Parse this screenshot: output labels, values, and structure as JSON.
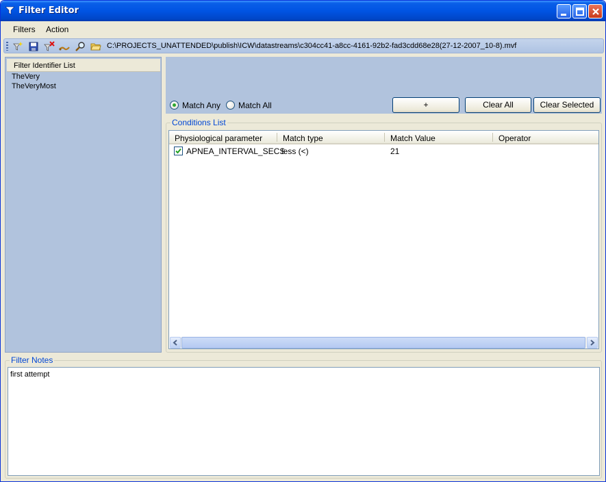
{
  "window": {
    "title": "Filter Editor"
  },
  "menu": {
    "filters": "Filters",
    "action": "Action"
  },
  "toolbar": {
    "icons": [
      "new-filter-icon",
      "save-icon",
      "delete-icon",
      "link-icon",
      "search-icon",
      "open-folder-icon"
    ],
    "path": "C:\\PROJECTS_UNATTENDED\\publish\\ICW\\datastreams\\c304cc41-a8cc-4161-92b2-fad3cdd68e28(27-12-2007_10-8).mvf"
  },
  "filter_list": {
    "header": "Filter Identifier List",
    "items": [
      "TheVery",
      "TheVeryMost"
    ]
  },
  "match": {
    "any_label": "Match Any",
    "all_label": "Match All",
    "selected": "any"
  },
  "buttons": {
    "add": "+",
    "clear_all": "Clear All",
    "clear_selected": "Clear Selected"
  },
  "conditions": {
    "title": "Conditions List",
    "columns": [
      "Physiological parameter",
      "Match type",
      "Match Value",
      "Operator"
    ],
    "rows": [
      {
        "checked": true,
        "parameter": "APNEA_INTERVAL_SECS",
        "match_type": "less (<)",
        "match_value": "21",
        "operator": ""
      }
    ]
  },
  "notes": {
    "title": "Filter Notes",
    "text": "first attempt"
  },
  "colors": {
    "panel": "#b1c3dd",
    "titlebar": "#0054e3",
    "group_title": "#0046d5"
  }
}
